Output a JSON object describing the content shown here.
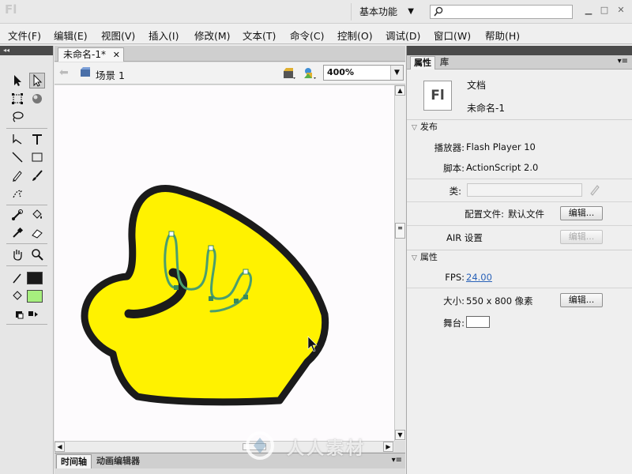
{
  "titlebar": {
    "app_logo": "Fl",
    "workspace": "基本功能",
    "search_placeholder": "",
    "window_controls": [
      "minimize-icon",
      "maximize-icon",
      "close-icon"
    ]
  },
  "menubar": {
    "items": [
      "文件(F)",
      "编辑(E)",
      "视图(V)",
      "插入(I)",
      "修改(M)",
      "文本(T)",
      "命令(C)",
      "控制(O)",
      "调试(D)",
      "窗口(W)",
      "帮助(H)"
    ]
  },
  "toolbox": {
    "collapse_icon": "◂◂",
    "stroke_color": "#1a1a1a",
    "fill_color": "#a6ef7e"
  },
  "document": {
    "tab_label": "未命名-1*",
    "scene_label": "场景 1",
    "zoom": "400%"
  },
  "stage": {
    "background": "#fdfbfd",
    "shape_fill": "#fff200",
    "shape_stroke": "#1b1b1b",
    "path_color": "#4a9e6e"
  },
  "timeline": {
    "tabs": [
      "时间轴",
      "动画编辑器"
    ]
  },
  "watermark": {
    "text": "人人素材"
  },
  "panel": {
    "tabs": [
      "属性",
      "库"
    ],
    "doc_icon": "Fl",
    "doc_type": "文档",
    "doc_name": "未命名-1",
    "publish_section": "发布",
    "player_label": "播放器:",
    "player_value": "Flash Player 10",
    "script_label": "脚本:",
    "script_value": "ActionScript 2.0",
    "class_label": "类:",
    "profile_label": "配置文件:",
    "profile_value": "默认文件",
    "edit_label": "编辑...",
    "air_label": "AIR 设置",
    "props_section": "属性",
    "fps_label": "FPS:",
    "fps_value": "24.00",
    "size_label": "大小:",
    "size_value": "550 x 800 像素",
    "stage_label": "舞台:",
    "stage_color": "#ffffff"
  }
}
